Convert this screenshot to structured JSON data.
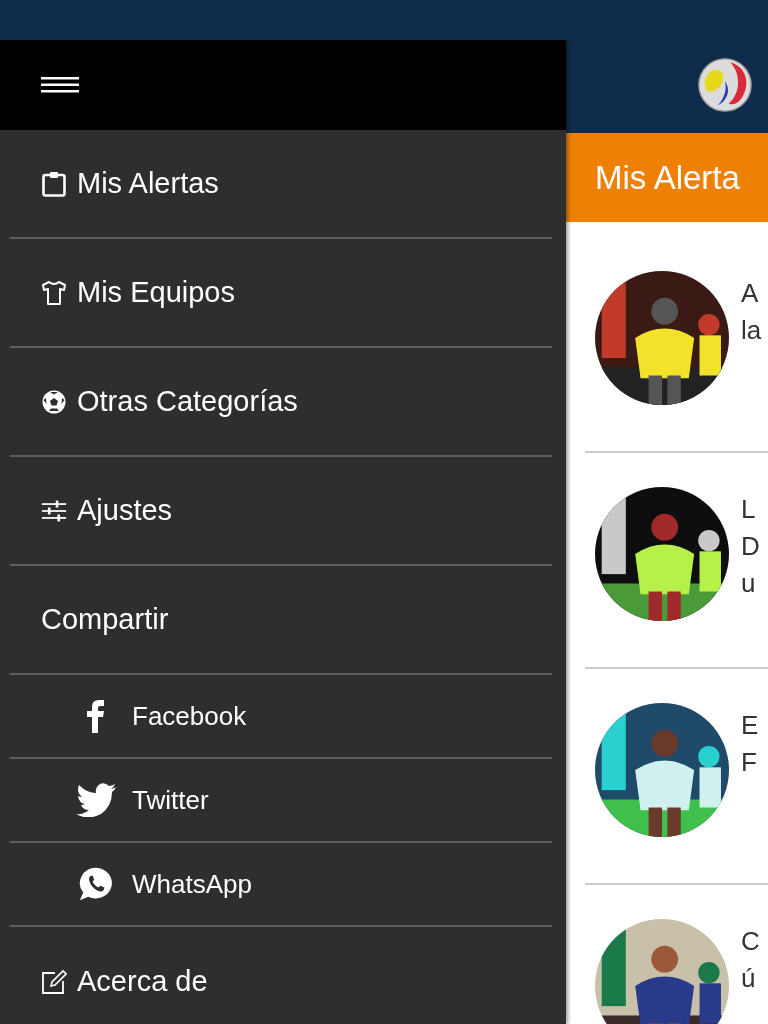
{
  "drawer": {
    "items": [
      {
        "kind": "item",
        "label": "Mis Alertas"
      },
      {
        "kind": "item",
        "label": "Mis Equipos"
      },
      {
        "kind": "item",
        "label": "Otras Categorías"
      },
      {
        "kind": "item",
        "label": "Ajustes"
      },
      {
        "kind": "section",
        "label": "Compartir"
      },
      {
        "kind": "share",
        "label": "Facebook"
      },
      {
        "kind": "share",
        "label": "Twitter"
      },
      {
        "kind": "share",
        "label": "WhatsApp"
      },
      {
        "kind": "item",
        "label": "Acerca de"
      }
    ]
  },
  "main": {
    "title": "Mis Alerta",
    "articles": [
      {
        "lines": [
          "A",
          "la"
        ]
      },
      {
        "lines": [
          "L",
          "D",
          "u"
        ]
      },
      {
        "lines": [
          "E",
          "F"
        ]
      },
      {
        "lines": [
          "C",
          "ú"
        ]
      }
    ]
  }
}
